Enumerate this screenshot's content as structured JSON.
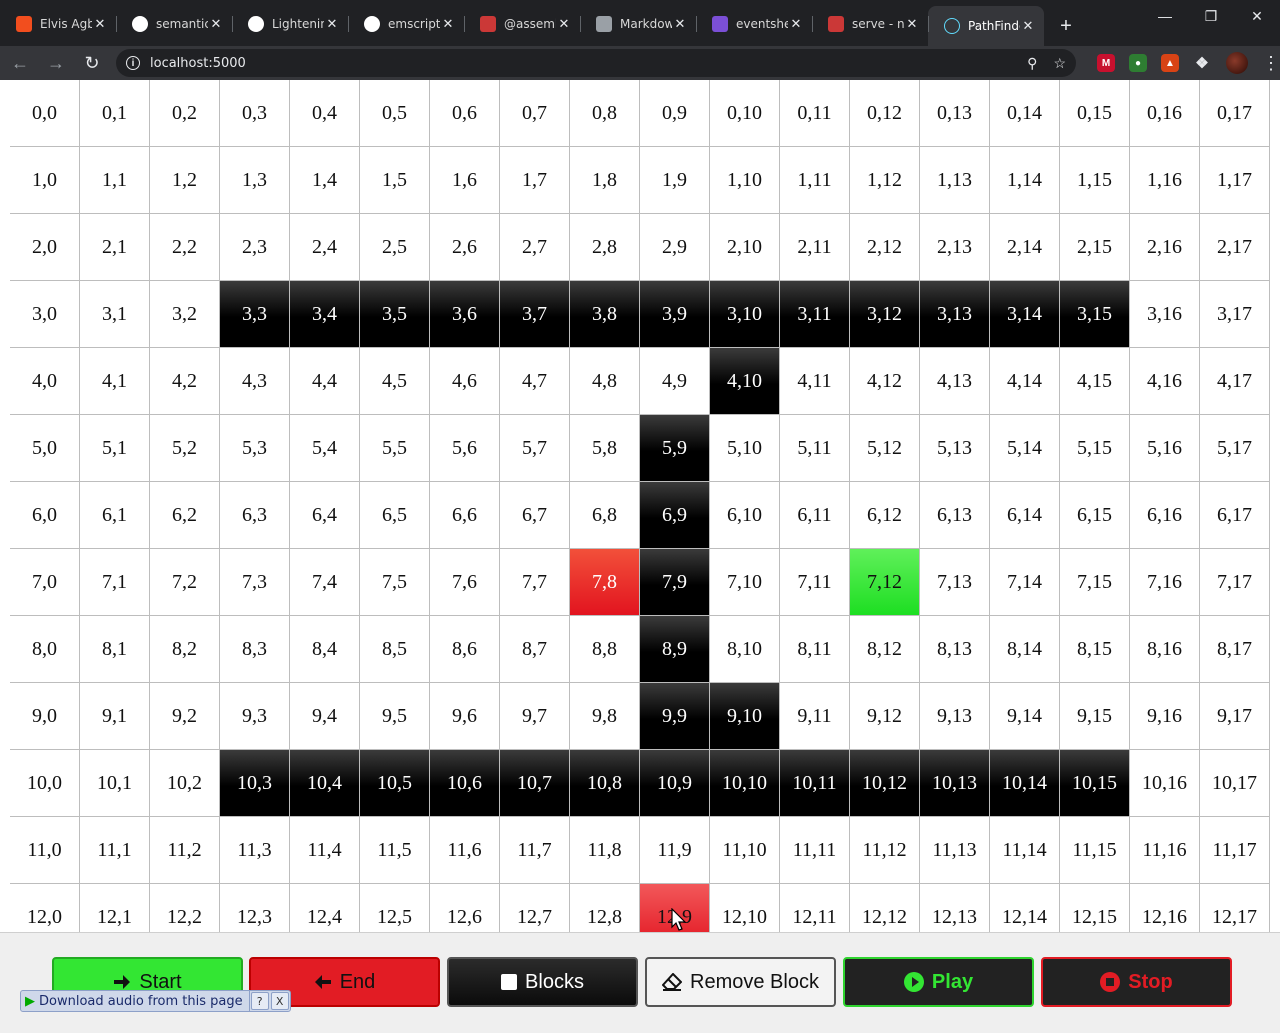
{
  "browser": {
    "tabs": [
      {
        "title": "Elvis Agbe",
        "icon": "figma-icon",
        "color": "#f24e1e",
        "active": false
      },
      {
        "title": "semantic",
        "icon": "google-icon",
        "color": "#ffffff",
        "active": false
      },
      {
        "title": "Lightening",
        "icon": "github-icon",
        "color": "#ffffff",
        "active": false
      },
      {
        "title": "emscripte",
        "icon": "google-icon",
        "color": "#ffffff",
        "active": false
      },
      {
        "title": "@assemb",
        "icon": "npm-icon",
        "color": "#cb3837",
        "active": false
      },
      {
        "title": "Markdow",
        "icon": "document-icon",
        "color": "#9aa0a6",
        "active": false
      },
      {
        "title": "eventshe",
        "icon": "h-icon",
        "color": "#7b4fd6",
        "active": false
      },
      {
        "title": "serve - np",
        "icon": "npm-icon",
        "color": "#cb3837",
        "active": false
      },
      {
        "title": "PathFinde",
        "icon": "react-icon",
        "color": "#61dafb",
        "active": true
      }
    ],
    "new_tab": "+",
    "url": "localhost:5000"
  },
  "grid": {
    "rows": 13,
    "cols": 18,
    "blocks": [
      "3,3",
      "3,4",
      "3,5",
      "3,6",
      "3,7",
      "3,8",
      "3,9",
      "3,10",
      "3,11",
      "3,12",
      "3,13",
      "3,14",
      "3,15",
      "4,10",
      "5,9",
      "6,9",
      "7,9",
      "8,9",
      "9,9",
      "9,10",
      "10,3",
      "10,4",
      "10,5",
      "10,6",
      "10,7",
      "10,8",
      "10,9",
      "10,10",
      "10,11",
      "10,12",
      "10,13",
      "10,14",
      "10,15"
    ],
    "start": "7,8",
    "end": "7,12",
    "path": [
      "12,9"
    ],
    "colors": {
      "block": "#000000",
      "start": "#e2141f",
      "end": "#1dde22",
      "path": "#e2141f"
    }
  },
  "controls": {
    "start": "Start",
    "end": "End",
    "blocks": "Blocks",
    "remove_block": "Remove Block",
    "play": "Play",
    "stop": "Stop"
  },
  "audio_toolbar": {
    "label": "Download audio from this page",
    "help": "?",
    "close": "X"
  }
}
